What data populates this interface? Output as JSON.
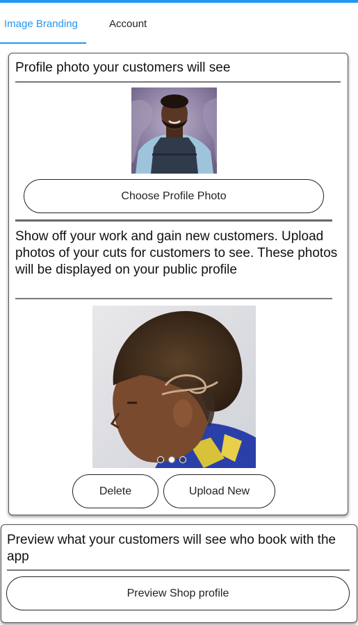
{
  "tabs": [
    {
      "label": "Image Branding",
      "active": true
    },
    {
      "label": "Account",
      "active": false
    }
  ],
  "profile_section": {
    "heading": "Profile photo your customers will see",
    "choose_button": "Choose Profile Photo"
  },
  "work_section": {
    "heading": "Show off your work and gain new customers. Upload photos of your cuts for customers to see. These photos will be displayed on your public profile",
    "carousel": {
      "count": 3,
      "active_index": 1
    },
    "delete_button": "Delete",
    "upload_button": "Upload New"
  },
  "preview_section": {
    "heading": "Preview what your customers will see who book with the app",
    "preview_button": "Preview Shop profile"
  },
  "colors": {
    "accent": "#2196f3"
  }
}
